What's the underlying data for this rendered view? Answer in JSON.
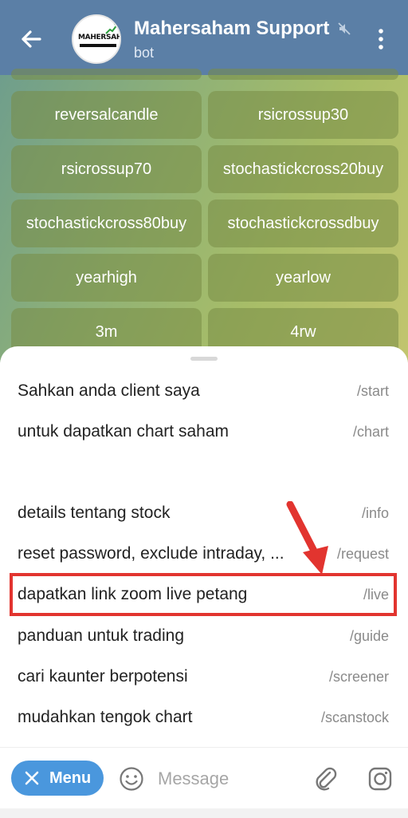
{
  "header": {
    "title": "Mahersaham Support",
    "subtitle": "bot",
    "logo_text": "MAHERSAHAM",
    "colors": {
      "bar": "#5b7fa6"
    }
  },
  "keyboard": {
    "buttons": [
      "reversalcandle",
      "rsicrossup30",
      "rsicrossup70",
      "stochastickcross20buy",
      "stochastickcross80buy",
      "stochastickcrossdbuy",
      "yearhigh",
      "yearlow",
      "3m",
      "4rw"
    ]
  },
  "commands": [
    {
      "desc": "Sahkan anda client saya",
      "cmd": "/start"
    },
    {
      "desc": "untuk dapatkan chart saham",
      "cmd": "/chart"
    },
    {
      "desc": "details tentang stock",
      "cmd": "/info"
    },
    {
      "desc": "reset password, exclude intraday, ...",
      "cmd": "/request"
    },
    {
      "desc": "dapatkan link zoom live petang",
      "cmd": "/live"
    },
    {
      "desc": "panduan untuk trading",
      "cmd": "/guide"
    },
    {
      "desc": "cari kaunter berpotensi",
      "cmd": "/screener"
    },
    {
      "desc": "mudahkan tengok chart",
      "cmd": "/scanstock"
    }
  ],
  "input": {
    "menu_label": "Menu",
    "placeholder": "Message"
  },
  "icons": [
    "back-arrow-icon",
    "mute-icon",
    "more-vertical-icon",
    "close-icon",
    "emoji-icon",
    "attach-icon",
    "camera-icon"
  ],
  "accent_colors": {
    "menu": "#4a97dd",
    "highlight": "#e2342f"
  }
}
